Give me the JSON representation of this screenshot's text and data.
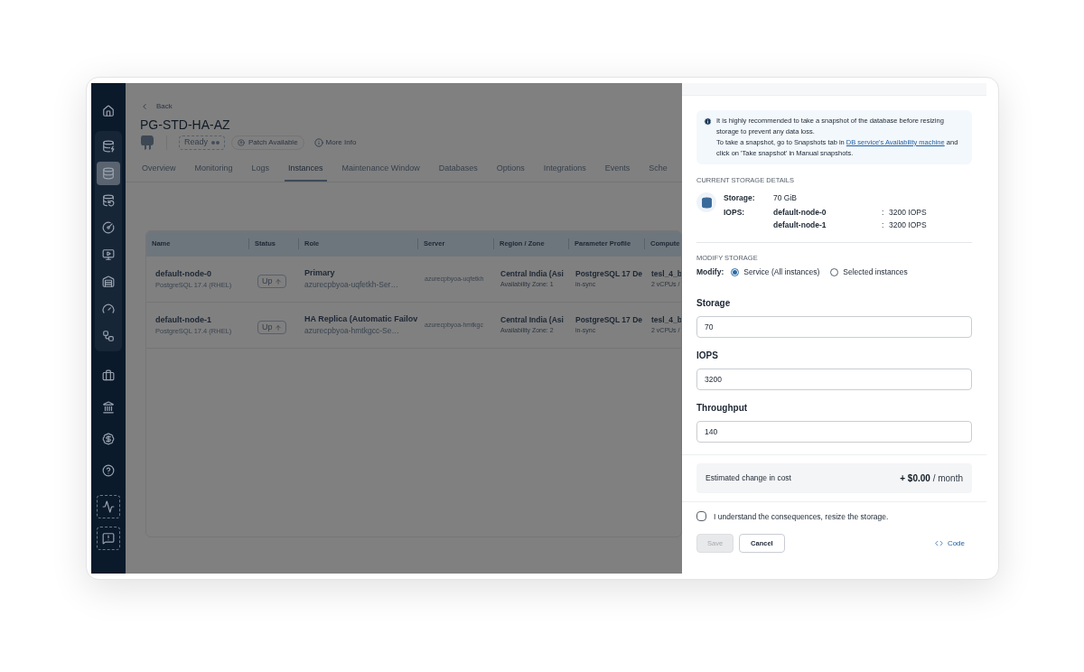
{
  "sidebar": {
    "items": [
      {
        "selected": false
      },
      {
        "selected": false
      },
      {
        "selected": true
      },
      {
        "selected": false
      },
      {
        "selected": false
      },
      {
        "selected": false
      },
      {
        "selected": false
      },
      {
        "selected": false
      },
      {
        "selected": false
      },
      {
        "selected": false
      },
      {
        "selected": false
      },
      {
        "selected": false
      },
      {
        "selected": false
      },
      {
        "selected": false
      },
      {
        "selected": false
      }
    ]
  },
  "header": {
    "back": "Back",
    "title": "PG-STD-HA-AZ",
    "status": "Ready",
    "patch": "Patch Available",
    "more_info": "More Info"
  },
  "tabs": [
    {
      "label": "Overview",
      "selected": false
    },
    {
      "label": "Monitoring",
      "selected": false
    },
    {
      "label": "Logs",
      "selected": false
    },
    {
      "label": "Instances",
      "selected": true
    },
    {
      "label": "Maintenance Window",
      "selected": false
    },
    {
      "label": "Databases",
      "selected": false
    },
    {
      "label": "Options",
      "selected": false
    },
    {
      "label": "Integrations",
      "selected": false
    },
    {
      "label": "Events",
      "selected": false
    },
    {
      "label": "Sche",
      "selected": false
    }
  ],
  "table": {
    "columns": [
      "Name",
      "Status",
      "Role",
      "Server",
      "Region / Zone",
      "Parameter Profile",
      "Compute"
    ],
    "rows": [
      {
        "name": "default-node-0",
        "engine": "PostgreSQL 17.4 (RHEL)",
        "status": "Up",
        "role": "Primary",
        "role_sub": "azurecpbyoa-uqfetkh-Ser…",
        "server": "azurecpbyoa-uqfetkh",
        "region": "Central India (Asi",
        "zone": "Availability Zone: 1",
        "profile": "PostgreSQL 17 De",
        "profile_sub": "in-sync",
        "compute": "tesl_4_b",
        "compute_sub": "2 vCPUs /"
      },
      {
        "name": "default-node-1",
        "engine": "PostgreSQL 17.4 (RHEL)",
        "status": "Up",
        "role": "HA Replica (Automatic Failov",
        "role_sub": "azurecpbyoa-hmtkgcc-Se…",
        "server": "azurecpbyoa-hmtkgc",
        "region": "Central India (Asi",
        "zone": "Availability Zone: 2",
        "profile": "PostgreSQL 17 De",
        "profile_sub": "in-sync",
        "compute": "tesl_4_b",
        "compute_sub": "2 vCPUs /"
      }
    ]
  },
  "drawer": {
    "notice": {
      "text_1": "It is highly recommended to take a snapshot of the database before resizing storage to prevent any data loss.",
      "text_2": "To take a snapshot, go to Snapshots tab in",
      "link": "DB service's Availability machine",
      "text_3": "and click on 'Take snapshot' in Manual snapshots."
    },
    "current_title": "CURRENT STORAGE DETAILS",
    "storage_label": "Storage:",
    "storage_value": "70 GiB",
    "iops_label": "IOPS:",
    "iops_rows": [
      {
        "node": "default-node-0",
        "sep": ":",
        "value": "3200 IOPS"
      },
      {
        "node": "default-node-1",
        "sep": ":",
        "value": "3200 IOPS"
      }
    ],
    "modify_title": "MODIFY STORAGE",
    "modify_label": "Modify:",
    "modify_options": [
      {
        "label": "Service (All instances)",
        "selected": true
      },
      {
        "label": "Selected instances",
        "selected": false
      }
    ],
    "fields": [
      {
        "label": "Storage",
        "value": "70"
      },
      {
        "label": "IOPS",
        "value": "3200"
      },
      {
        "label": "Throughput",
        "value": "140"
      }
    ],
    "cost_label": "Estimated change in cost",
    "cost_value": "+ $0.00",
    "cost_unit": "/ month",
    "confirm": {
      "label": "I understand the consequences, resize the storage.",
      "checked": false
    },
    "save": {
      "label": "Save",
      "disabled": true
    },
    "cancel": "Cancel",
    "code": "Code"
  }
}
